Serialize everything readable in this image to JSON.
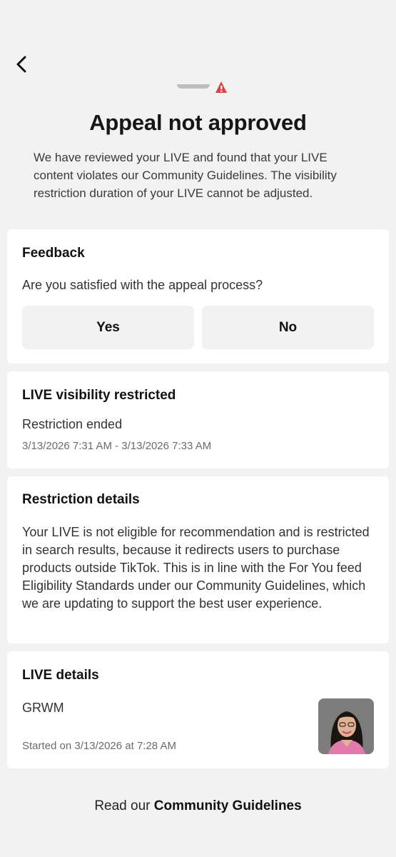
{
  "header": {
    "back_icon": "chevron-left-icon",
    "hero_icon": "warning-triangle-icon"
  },
  "status": {
    "title": "Appeal not approved",
    "description": "We have reviewed your LIVE and found that your LIVE content violates our Community Guidelines. The visibility restriction duration of your LIVE cannot be adjusted."
  },
  "feedback": {
    "title": "Feedback",
    "question": "Are you satisfied with the appeal process?",
    "yes_label": "Yes",
    "no_label": "No"
  },
  "visibility": {
    "title": "LIVE visibility restricted",
    "status": "Restriction ended",
    "period": "3/13/2026 7:31 AM - 3/13/2026 7:33 AM"
  },
  "restriction_details": {
    "title": "Restriction details",
    "body": "Your LIVE is not eligible for recommendation and is restricted in search results, because it redirects users to purchase products outside TikTok. This is in line with the For You feed Eligibility Standards under our Community Guidelines, which we are updating to support the best user experience."
  },
  "live_details": {
    "title": "LIVE details",
    "name": "GRWM",
    "started": "Started on 3/13/2026 at 7:28 AM"
  },
  "footer": {
    "prefix": "Read our ",
    "link": "Community Guidelines"
  },
  "colors": {
    "background": "#f2f2f2",
    "card": "#ffffff",
    "button": "#f1f1f1",
    "warning": "#ee3a3a"
  }
}
